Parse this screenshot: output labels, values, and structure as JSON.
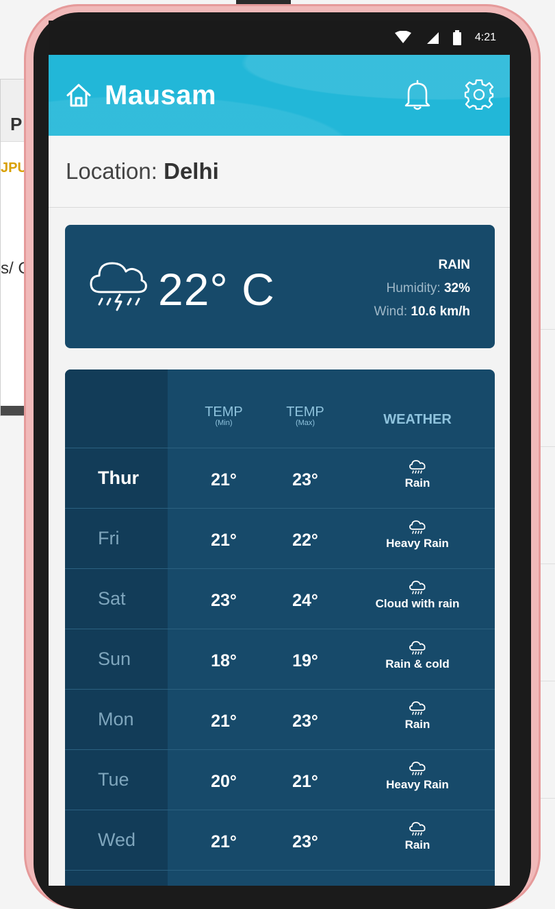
{
  "status_bar": {
    "time": "4:21"
  },
  "header": {
    "title": "Mausam"
  },
  "location": {
    "label": "Location:",
    "value": "Delhi"
  },
  "current": {
    "temperature": "22° C",
    "condition": "RAIN",
    "humidity_label": "Humidity:",
    "humidity_value": "32%",
    "wind_label": "Wind:",
    "wind_value": "10.6 km/h"
  },
  "forecast": {
    "headers": {
      "temp": "TEMP",
      "min_note": "(Min)",
      "max_note": "(Max)",
      "weather": "WEATHER"
    },
    "rows": [
      {
        "day": "Thur",
        "min": "21°",
        "max": "23°",
        "weather": "Rain"
      },
      {
        "day": "Fri",
        "min": "21°",
        "max": "22°",
        "weather": "Heavy Rain"
      },
      {
        "day": "Sat",
        "min": "23°",
        "max": "24°",
        "weather": "Cloud with rain"
      },
      {
        "day": "Sun",
        "min": "18°",
        "max": "19°",
        "weather": "Rain & cold"
      },
      {
        "day": "Mon",
        "min": "21°",
        "max": "23°",
        "weather": "Rain"
      },
      {
        "day": "Tue",
        "min": "20°",
        "max": "21°",
        "weather": "Heavy Rain"
      },
      {
        "day": "Wed",
        "min": "21°",
        "max": "23°",
        "weather": "Rain"
      }
    ]
  },
  "background_window": {
    "letter": "P",
    "orange_text": "JPU",
    "slash_text": "s/ C"
  },
  "colors": {
    "header": "#22b7d8",
    "card": "#174a6a",
    "day_column": "#123c58",
    "phone_frame": "#f0b9b9"
  }
}
